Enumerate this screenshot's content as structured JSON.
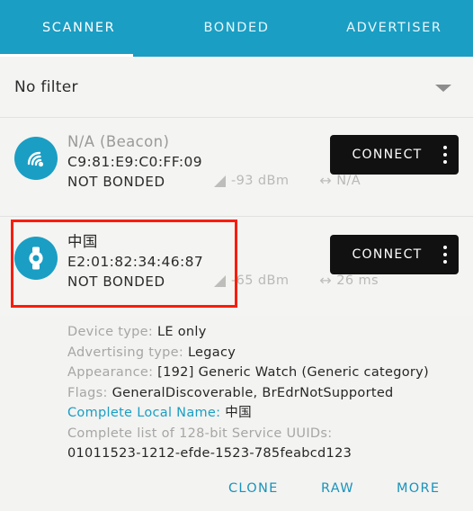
{
  "header": {
    "tabs": [
      {
        "label": "SCANNER",
        "active": true
      },
      {
        "label": "BONDED",
        "active": false
      },
      {
        "label": "ADVERTISER",
        "active": false
      }
    ],
    "accent_color": "#1a9ec4"
  },
  "filter": {
    "label": "No filter",
    "caret_icon": "chevron-down-icon"
  },
  "devices": [
    {
      "icon": "beacon-icon",
      "name": "N/A (Beacon)",
      "name_is_placeholder": true,
      "mac": "C9:81:E9:C0:FF:09",
      "bond_state": "NOT BONDED",
      "rssi": "-93 dBm",
      "interval": "N/A",
      "connect_label": "CONNECT",
      "menu_icon": "kebab-menu-icon"
    },
    {
      "icon": "watch-icon",
      "name": "中国",
      "name_is_placeholder": false,
      "mac": "E2:01:82:34:46:87",
      "bond_state": "NOT BONDED",
      "rssi": "-65 dBm",
      "interval": "26 ms",
      "connect_label": "CONNECT",
      "menu_icon": "kebab-menu-icon"
    }
  ],
  "annotation": {
    "color": "#fa1c09"
  },
  "details": [
    {
      "label": "Device type:",
      "value": "LE only",
      "accent": false
    },
    {
      "label": "Advertising type:",
      "value": "Legacy",
      "accent": false
    },
    {
      "label": "Appearance:",
      "value": "[192] Generic Watch (Generic category)",
      "accent": false
    },
    {
      "label": "Flags:",
      "value": "GeneralDiscoverable, BrEdrNotSupported",
      "accent": false
    },
    {
      "label": "Complete Local Name:",
      "value": "中国",
      "accent": true
    },
    {
      "label": "Complete list of 128-bit Service UUIDs:",
      "value": "",
      "accent": false
    }
  ],
  "uuid": "01011523-1212-efde-1523-785feabcd123",
  "actions": [
    {
      "label": "CLONE"
    },
    {
      "label": "RAW"
    },
    {
      "label": "MORE"
    }
  ]
}
